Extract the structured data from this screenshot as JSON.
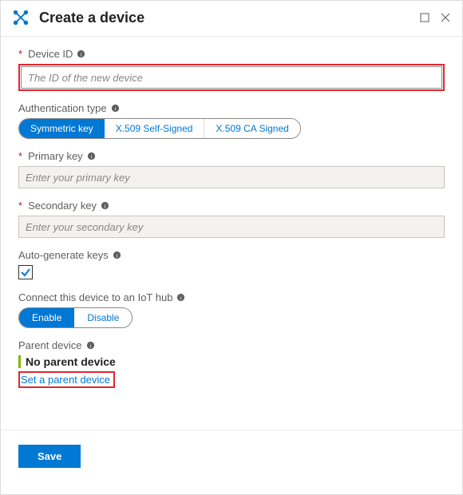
{
  "header": {
    "title": "Create a device"
  },
  "deviceId": {
    "label": "Device ID",
    "placeholder": "The ID of the new device"
  },
  "authType": {
    "label": "Authentication type",
    "options": {
      "symmetric": "Symmetric key",
      "selfSigned": "X.509 Self-Signed",
      "caSigned": "X.509 CA Signed"
    }
  },
  "primaryKey": {
    "label": "Primary key",
    "placeholder": "Enter your primary key"
  },
  "secondaryKey": {
    "label": "Secondary key",
    "placeholder": "Enter your secondary key"
  },
  "autoGen": {
    "label": "Auto-generate keys"
  },
  "iotHub": {
    "label": "Connect this device to an IoT hub",
    "enable": "Enable",
    "disable": "Disable"
  },
  "parent": {
    "label": "Parent device",
    "none": "No parent device",
    "link": "Set a parent device"
  },
  "footer": {
    "save": "Save"
  }
}
